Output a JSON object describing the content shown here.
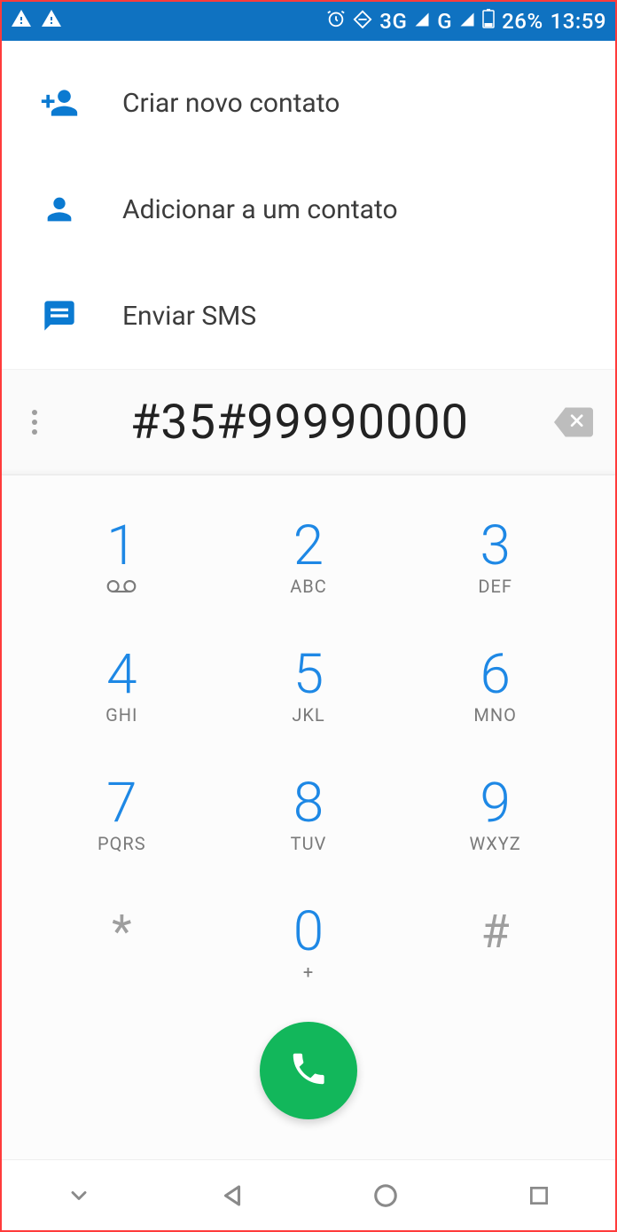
{
  "status": {
    "network1": "3G",
    "network2": "G",
    "battery_percent": "26%",
    "time": "13:59"
  },
  "actions": {
    "create_contact": "Criar novo contato",
    "add_to_contact": "Adicionar a um contato",
    "send_sms": "Enviar SMS"
  },
  "dialer": {
    "number": "#35#99990000"
  },
  "keypad": [
    {
      "digit": "1",
      "letters": "voicemail"
    },
    {
      "digit": "2",
      "letters": "ABC"
    },
    {
      "digit": "3",
      "letters": "DEF"
    },
    {
      "digit": "4",
      "letters": "GHI"
    },
    {
      "digit": "5",
      "letters": "JKL"
    },
    {
      "digit": "6",
      "letters": "MNO"
    },
    {
      "digit": "7",
      "letters": "PQRS"
    },
    {
      "digit": "8",
      "letters": "TUV"
    },
    {
      "digit": "9",
      "letters": "WXYZ"
    },
    {
      "digit": "*",
      "letters": ""
    },
    {
      "digit": "0",
      "letters": "+"
    },
    {
      "digit": "#",
      "letters": ""
    }
  ]
}
